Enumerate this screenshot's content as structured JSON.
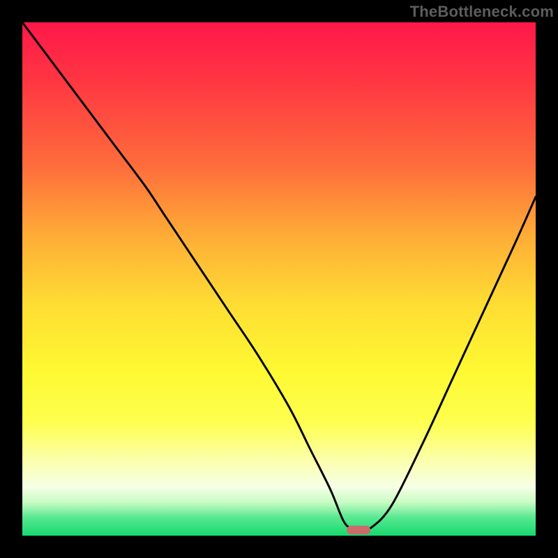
{
  "watermark": "TheBottleneck.com",
  "chart_data": {
    "type": "line",
    "title": "",
    "xlabel": "",
    "ylabel": "",
    "xlim": [
      0,
      100
    ],
    "ylim": [
      0,
      100
    ],
    "legend": false,
    "grid": false,
    "background_gradient_stops": [
      {
        "offset": 0.0,
        "color": "#ff1749"
      },
      {
        "offset": 0.12,
        "color": "#ff3842"
      },
      {
        "offset": 0.28,
        "color": "#fe6d3c"
      },
      {
        "offset": 0.42,
        "color": "#feae36"
      },
      {
        "offset": 0.55,
        "color": "#fedd33"
      },
      {
        "offset": 0.68,
        "color": "#fef932"
      },
      {
        "offset": 0.78,
        "color": "#feff4f"
      },
      {
        "offset": 0.85,
        "color": "#fcffa8"
      },
      {
        "offset": 0.905,
        "color": "#f6ffe6"
      },
      {
        "offset": 0.935,
        "color": "#c8fcc3"
      },
      {
        "offset": 0.965,
        "color": "#57e890"
      },
      {
        "offset": 1.0,
        "color": "#16d96e"
      }
    ],
    "series": [
      {
        "name": "bottleneck-curve",
        "color": "#000000",
        "x": [
          0,
          6,
          12,
          18,
          24,
          28,
          34,
          40,
          46,
          52,
          56,
          60,
          62.5,
          64,
          66,
          68,
          72,
          78,
          84,
          90,
          96,
          100
        ],
        "y": [
          100,
          92,
          84,
          76,
          68,
          62,
          53,
          44,
          35,
          25,
          17,
          9,
          3,
          1.5,
          1.4,
          1.6,
          6,
          18,
          31,
          44,
          57,
          66
        ]
      }
    ],
    "marker": {
      "name": "optimal-point",
      "shape": "rounded-rect",
      "x": 65.5,
      "y": 1.1,
      "width_pct": 4.6,
      "height_pct": 1.7,
      "color": "#cb6a6a"
    }
  }
}
